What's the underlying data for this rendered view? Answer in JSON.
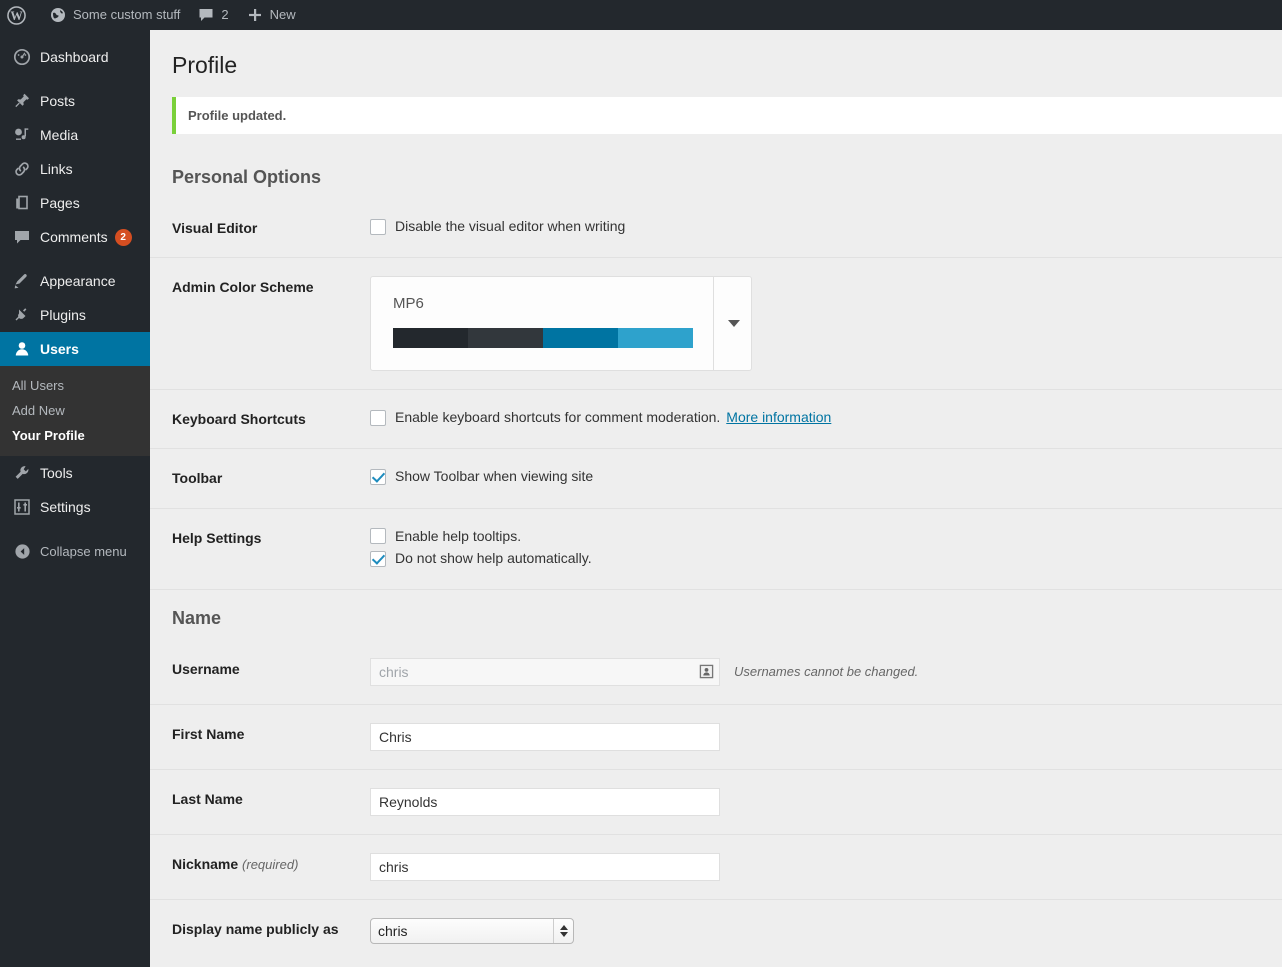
{
  "adminbar": {
    "logo_icon": "wordpress-logo-icon",
    "site_icon": "globe-icon",
    "site_name": "Some custom stuff",
    "comments_icon": "comment-bubble-icon",
    "comments_count": "2",
    "new_icon": "plus-icon",
    "new_label": "New"
  },
  "sidebar": {
    "items": [
      {
        "label": "Dashboard",
        "icon": "dashboard-icon",
        "name": "dashboard"
      },
      {
        "label": "Posts",
        "icon": "pin-icon",
        "name": "posts"
      },
      {
        "label": "Media",
        "icon": "media-icon",
        "name": "media"
      },
      {
        "label": "Links",
        "icon": "link-icon",
        "name": "links"
      },
      {
        "label": "Pages",
        "icon": "pages-icon",
        "name": "pages"
      },
      {
        "label": "Comments",
        "icon": "comment-bubble-icon",
        "name": "comments",
        "badge": "2"
      },
      {
        "label": "Appearance",
        "icon": "paintbrush-icon",
        "name": "appearance"
      },
      {
        "label": "Plugins",
        "icon": "plug-icon",
        "name": "plugins"
      },
      {
        "label": "Users",
        "icon": "user-icon",
        "name": "users",
        "current": true
      },
      {
        "label": "Tools",
        "icon": "wrench-icon",
        "name": "tools"
      },
      {
        "label": "Settings",
        "icon": "sliders-icon",
        "name": "settings"
      }
    ],
    "users_submenu": [
      {
        "label": "All Users",
        "name": "all-users"
      },
      {
        "label": "Add New",
        "name": "add-new-user"
      },
      {
        "label": "Your Profile",
        "name": "your-profile",
        "current": true
      }
    ],
    "collapse": {
      "label": "Collapse menu",
      "icon": "collapse-arrow-icon"
    },
    "badge_color": "#d54e21",
    "current_color": "#0074a2"
  },
  "page": {
    "title": "Profile",
    "notice": "Profile updated.",
    "notice_accent": "#7ad03a"
  },
  "personal_options": {
    "heading": "Personal Options",
    "visual_editor": {
      "label": "Visual Editor",
      "checkbox_label": "Disable the visual editor when writing",
      "checked": false
    },
    "admin_color_scheme": {
      "label": "Admin Color Scheme",
      "selected": "MP6",
      "swatches": [
        "#23282d",
        "#32373c",
        "#0074a2",
        "#2ea2cc"
      ],
      "toggle_icon": "chevron-down-icon"
    },
    "keyboard_shortcuts": {
      "label": "Keyboard Shortcuts",
      "checkbox_label": "Enable keyboard shortcuts for comment moderation.",
      "link_label": "More information",
      "checked": false
    },
    "toolbar": {
      "label": "Toolbar",
      "checkbox_label": "Show Toolbar when viewing site",
      "checked": true
    },
    "help_settings": {
      "label": "Help Settings",
      "options": [
        {
          "checkbox_label": "Enable help tooltips.",
          "checked": false
        },
        {
          "checkbox_label": "Do not show help automatically.",
          "checked": true
        }
      ]
    }
  },
  "name_section": {
    "heading": "Name",
    "username": {
      "label": "Username",
      "value": "chris",
      "icon": "id-card-icon",
      "description": "Usernames cannot be changed."
    },
    "first_name": {
      "label": "First Name",
      "value": "Chris"
    },
    "last_name": {
      "label": "Last Name",
      "value": "Reynolds"
    },
    "nickname": {
      "label": "Nickname",
      "required_note": "(required)",
      "value": "chris"
    },
    "display_name": {
      "label": "Display name publicly as",
      "value": "chris",
      "options": [
        "chris"
      ]
    }
  }
}
